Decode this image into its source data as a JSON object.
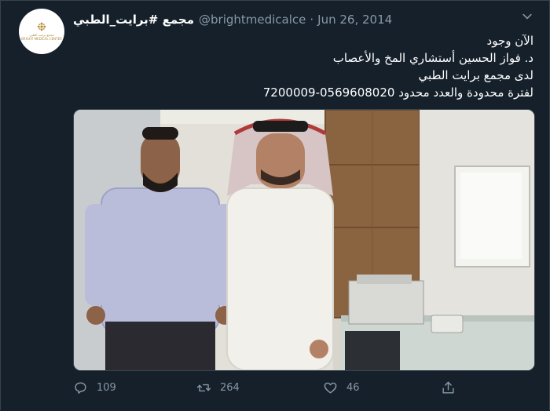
{
  "tweet": {
    "display_name": "مجمع #برايت_الطبي",
    "handle": "@brightmedicalce",
    "separator": "·",
    "date": "Jun 26, 2014",
    "avatar_logo_text": "مجمع برايت الطبي",
    "avatar_logo_text_en": "BRIGHT MEDICAL CENTER",
    "text_lines": [
      "الآن وجود",
      "د. فواز الحسين أستشاري المخ والأعصاب",
      "لدى مجمع برايت الطبي",
      "لفترة محدودة والعدد محدود 0569608020-7200009"
    ],
    "image_icon": "photo-two-men-in-clinic"
  },
  "actions": {
    "reply_count": "109",
    "retweet_count": "264",
    "like_count": "46"
  },
  "icons": {
    "reply": "reply-icon",
    "retweet": "retweet-icon",
    "like": "heart-icon",
    "share": "share-icon",
    "menu": "chevron-down-icon"
  },
  "colors": {
    "background": "#15202b",
    "muted": "#8899a6",
    "border": "#38444d",
    "text": "#ffffff",
    "logo_gold": "#b08a3a"
  }
}
